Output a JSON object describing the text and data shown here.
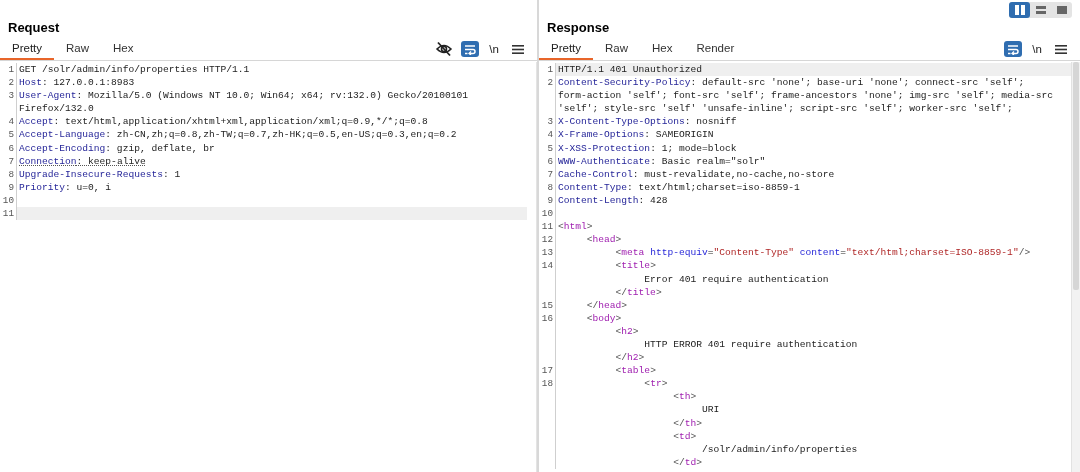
{
  "layout_toggle": [
    {
      "kind": "columns",
      "selected": true
    },
    {
      "kind": "rows",
      "selected": false
    },
    {
      "kind": "single",
      "selected": false
    }
  ],
  "request": {
    "title": "Request",
    "tabs": [
      {
        "label": "Pretty",
        "selected": true
      },
      {
        "label": "Raw",
        "selected": false
      },
      {
        "label": "Hex",
        "selected": false
      }
    ],
    "toolbar": [
      {
        "kind": "hide"
      },
      {
        "kind": "wrap",
        "selected": true
      },
      {
        "kind": "text",
        "label": "\\n"
      },
      {
        "kind": "menu"
      }
    ],
    "lines": [
      {
        "number": "1",
        "current": false,
        "underlined": false,
        "tokens": [
          {
            "kind": "plain",
            "text": "GET /solr/admin/info/properties HTTP/1.1"
          }
        ]
      },
      {
        "number": "2",
        "current": false,
        "underlined": false,
        "tokens": [
          {
            "kind": "name",
            "text": "Host"
          },
          {
            "kind": "plain",
            "text": ": 127.0.0.1:8983"
          }
        ]
      },
      {
        "number": "3",
        "current": false,
        "underlined": false,
        "tokens": [
          {
            "kind": "name",
            "text": "User-Agent"
          },
          {
            "kind": "plain",
            "text": ": Mozilla/5.0 (Windows NT 10.0; Win64; x64; rv:132.0) Gecko/20100101"
          }
        ]
      },
      {
        "current": false,
        "underlined": false,
        "tokens": [
          {
            "kind": "plain",
            "text": "Firefox/132.0"
          }
        ]
      },
      {
        "number": "4",
        "current": false,
        "underlined": false,
        "tokens": [
          {
            "kind": "name",
            "text": "Accept"
          },
          {
            "kind": "plain",
            "text": ": text/html,application/xhtml+xml,application/xml;q=0.9,*/*;q=0.8"
          }
        ]
      },
      {
        "number": "5",
        "current": false,
        "underlined": false,
        "tokens": [
          {
            "kind": "name",
            "text": "Accept-Language"
          },
          {
            "kind": "plain",
            "text": ": zh-CN,zh;q=0.8,zh-TW;q=0.7,zh-HK;q=0.5,en-US;q=0.3,en;q=0.2"
          }
        ]
      },
      {
        "number": "6",
        "current": false,
        "underlined": false,
        "tokens": [
          {
            "kind": "name",
            "text": "Accept-Encoding"
          },
          {
            "kind": "plain",
            "text": ": gzip, deflate, br"
          }
        ]
      },
      {
        "number": "7",
        "current": false,
        "underlined": true,
        "tokens": [
          {
            "kind": "name",
            "text": "Connection"
          },
          {
            "kind": "plain",
            "text": ": keep-alive"
          }
        ]
      },
      {
        "number": "8",
        "current": false,
        "underlined": false,
        "tokens": [
          {
            "kind": "name",
            "text": "Upgrade-Insecure-Requests"
          },
          {
            "kind": "plain",
            "text": ": 1"
          }
        ]
      },
      {
        "number": "9",
        "current": false,
        "underlined": false,
        "tokens": [
          {
            "kind": "name",
            "text": "Priority"
          },
          {
            "kind": "plain",
            "text": ": u=0, i"
          }
        ]
      },
      {
        "number": "10",
        "current": false
      },
      {
        "number": "11",
        "current": true
      }
    ]
  },
  "response": {
    "title": "Response",
    "tabs": [
      {
        "label": "Pretty",
        "selected": true
      },
      {
        "label": "Raw",
        "selected": false
      },
      {
        "label": "Hex",
        "selected": false
      },
      {
        "label": "Render",
        "selected": false
      }
    ],
    "toolbar": [
      {
        "kind": "wrap",
        "selected": true
      },
      {
        "kind": "text",
        "label": "\\n"
      },
      {
        "kind": "menu"
      }
    ],
    "lines": [
      {
        "number": "1",
        "current": true,
        "underlined": false,
        "tokens": [
          {
            "kind": "plain",
            "text": "HTTP/1.1 401 Unauthorized"
          }
        ]
      },
      {
        "number": "2",
        "current": false,
        "underlined": false,
        "tokens": [
          {
            "kind": "name",
            "text": "Content-Security-Policy"
          },
          {
            "kind": "plain",
            "text": ": default-src 'none'; base-uri 'none'; connect-src 'self';"
          }
        ]
      },
      {
        "current": false,
        "underlined": false,
        "tokens": [
          {
            "kind": "plain",
            "text": "form-action 'self'; font-src 'self'; frame-ancestors 'none'; img-src 'self'; media-src"
          }
        ]
      },
      {
        "current": false,
        "underlined": false,
        "tokens": [
          {
            "kind": "plain",
            "text": "'self'; style-src 'self' 'unsafe-inline'; script-src 'self'; worker-src 'self';"
          }
        ]
      },
      {
        "number": "3",
        "current": false,
        "underlined": false,
        "tokens": [
          {
            "kind": "name",
            "text": "X-Content-Type-Options"
          },
          {
            "kind": "plain",
            "text": ": nosniff"
          }
        ]
      },
      {
        "number": "4",
        "current": false,
        "underlined": false,
        "tokens": [
          {
            "kind": "name",
            "text": "X-Frame-Options"
          },
          {
            "kind": "plain",
            "text": ": SAMEORIGIN"
          }
        ]
      },
      {
        "number": "5",
        "current": false,
        "underlined": false,
        "tokens": [
          {
            "kind": "name",
            "text": "X-XSS-Protection"
          },
          {
            "kind": "plain",
            "text": ": 1; mode=block"
          }
        ]
      },
      {
        "number": "6",
        "current": false,
        "underlined": false,
        "tokens": [
          {
            "kind": "name",
            "text": "WWW-Authenticate"
          },
          {
            "kind": "plain",
            "text": ": Basic realm=\"solr\""
          }
        ]
      },
      {
        "number": "7",
        "current": false,
        "underlined": false,
        "tokens": [
          {
            "kind": "name",
            "text": "Cache-Control"
          },
          {
            "kind": "plain",
            "text": ": must-revalidate,no-cache,no-store"
          }
        ]
      },
      {
        "number": "8",
        "current": false,
        "underlined": false,
        "tokens": [
          {
            "kind": "name",
            "text": "Content-Type"
          },
          {
            "kind": "plain",
            "text": ": text/html;charset=iso-8859-1"
          }
        ]
      },
      {
        "number": "9",
        "current": false,
        "underlined": false,
        "tokens": [
          {
            "kind": "name",
            "text": "Content-Length"
          },
          {
            "kind": "plain",
            "text": ": 428"
          }
        ]
      },
      {
        "number": "10",
        "current": false
      },
      {
        "number": "11",
        "current": false,
        "underlined": false,
        "tokens": [
          {
            "kind": "bracket",
            "text": "<"
          },
          {
            "kind": "tag",
            "text": "html"
          },
          {
            "kind": "bracket",
            "text": ">"
          }
        ]
      },
      {
        "number": "12",
        "current": false,
        "underlined": false,
        "tokens": [
          {
            "kind": "bracket",
            "text": "     <"
          },
          {
            "kind": "tag",
            "text": "head"
          },
          {
            "kind": "bracket",
            "text": ">"
          }
        ]
      },
      {
        "number": "13",
        "current": false,
        "underlined": false,
        "tokens": [
          {
            "kind": "bracket",
            "text": "          <"
          },
          {
            "kind": "tag",
            "text": "meta "
          },
          {
            "kind": "attr",
            "text": "http-equiv"
          },
          {
            "kind": "plain",
            "text": "="
          },
          {
            "kind": "value",
            "text": "\"Content-Type\" "
          },
          {
            "kind": "attr",
            "text": "content"
          },
          {
            "kind": "plain",
            "text": "="
          },
          {
            "kind": "value",
            "text": "\"text/html;charset=ISO-8859-1\""
          },
          {
            "kind": "bracket",
            "text": "/>"
          }
        ]
      },
      {
        "number": "14",
        "current": false,
        "underlined": false,
        "tokens": [
          {
            "kind": "bracket",
            "text": "          <"
          },
          {
            "kind": "tag",
            "text": "title"
          },
          {
            "kind": "bracket",
            "text": ">"
          }
        ]
      },
      {
        "current": false,
        "underlined": false,
        "tokens": [
          {
            "kind": "plain",
            "text": "               Error 401 require authentication"
          }
        ]
      },
      {
        "current": false,
        "underlined": false,
        "tokens": [
          {
            "kind": "bracket",
            "text": "          </"
          },
          {
            "kind": "tag",
            "text": "title"
          },
          {
            "kind": "bracket",
            "text": ">"
          }
        ]
      },
      {
        "number": "15",
        "current": false,
        "underlined": false,
        "tokens": [
          {
            "kind": "bracket",
            "text": "     </"
          },
          {
            "kind": "tag",
            "text": "head"
          },
          {
            "kind": "bracket",
            "text": ">"
          }
        ]
      },
      {
        "number": "16",
        "current": false,
        "underlined": false,
        "tokens": [
          {
            "kind": "bracket",
            "text": "     <"
          },
          {
            "kind": "tag",
            "text": "body"
          },
          {
            "kind": "bracket",
            "text": ">"
          }
        ]
      },
      {
        "current": false,
        "underlined": false,
        "tokens": [
          {
            "kind": "bracket",
            "text": "          <"
          },
          {
            "kind": "tag",
            "text": "h2"
          },
          {
            "kind": "bracket",
            "text": ">"
          }
        ]
      },
      {
        "current": false,
        "underlined": false,
        "tokens": [
          {
            "kind": "plain",
            "text": "               HTTP ERROR 401 require authentication"
          }
        ]
      },
      {
        "current": false,
        "underlined": false,
        "tokens": [
          {
            "kind": "bracket",
            "text": "          </"
          },
          {
            "kind": "tag",
            "text": "h2"
          },
          {
            "kind": "bracket",
            "text": ">"
          }
        ]
      },
      {
        "number": "17",
        "current": false,
        "underlined": false,
        "tokens": [
          {
            "kind": "bracket",
            "text": "          <"
          },
          {
            "kind": "tag",
            "text": "table"
          },
          {
            "kind": "bracket",
            "text": ">"
          }
        ]
      },
      {
        "number": "18",
        "current": false,
        "underlined": false,
        "tokens": [
          {
            "kind": "bracket",
            "text": "               <"
          },
          {
            "kind": "tag",
            "text": "tr"
          },
          {
            "kind": "bracket",
            "text": ">"
          }
        ]
      },
      {
        "current": false,
        "underlined": false,
        "tokens": [
          {
            "kind": "bracket",
            "text": "                    <"
          },
          {
            "kind": "tag",
            "text": "th"
          },
          {
            "kind": "bracket",
            "text": ">"
          }
        ]
      },
      {
        "current": false,
        "underlined": false,
        "tokens": [
          {
            "kind": "plain",
            "text": "                         URI"
          }
        ]
      },
      {
        "current": false,
        "underlined": false,
        "tokens": [
          {
            "kind": "bracket",
            "text": "                    </"
          },
          {
            "kind": "tag",
            "text": "th"
          },
          {
            "kind": "bracket",
            "text": ">"
          }
        ]
      },
      {
        "current": false,
        "underlined": false,
        "tokens": [
          {
            "kind": "bracket",
            "text": "                    <"
          },
          {
            "kind": "tag",
            "text": "td"
          },
          {
            "kind": "bracket",
            "text": ">"
          }
        ]
      },
      {
        "current": false,
        "underlined": false,
        "tokens": [
          {
            "kind": "plain",
            "text": "                         /solr/admin/info/properties"
          }
        ]
      },
      {
        "current": false,
        "underlined": false,
        "tokens": [
          {
            "kind": "bracket",
            "text": "                    </"
          },
          {
            "kind": "tag",
            "text": "td"
          },
          {
            "kind": "bracket",
            "text": ">"
          }
        ]
      }
    ]
  }
}
